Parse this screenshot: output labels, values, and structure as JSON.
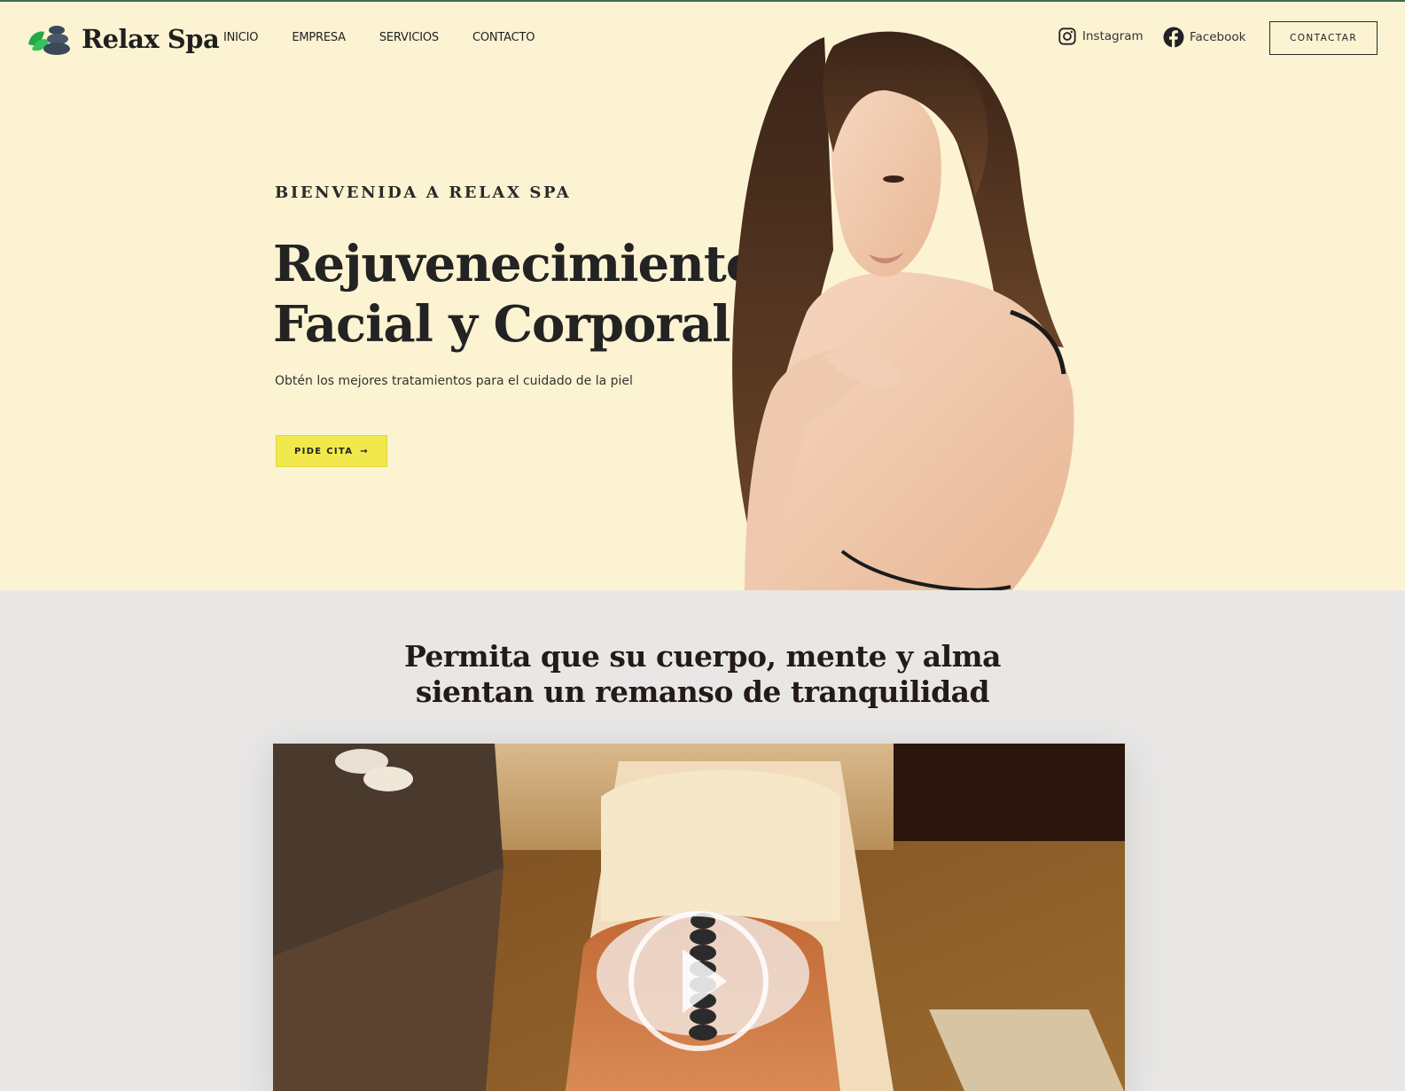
{
  "brand": {
    "name": "Relax Spa",
    "logo_icon": "spa-stones-leaf-icon"
  },
  "nav": {
    "items": [
      {
        "label": "INICIO"
      },
      {
        "label": "EMPRESA"
      },
      {
        "label": "SERVICIOS"
      },
      {
        "label": "CONTACTO"
      }
    ]
  },
  "social": {
    "instagram": {
      "label": "Instagram",
      "icon": "instagram-icon"
    },
    "facebook": {
      "label": "Facebook",
      "icon": "facebook-icon"
    }
  },
  "header": {
    "contact_button": "CONTACTAR"
  },
  "hero": {
    "eyebrow": "BIENVENIDA A RELAX SPA",
    "headline_line1": "Rejuvenecimiento",
    "headline_line2": "Facial y Corporal",
    "subtitle": "Obtén los mejores tratamientos para el cuidado de la piel",
    "cta_label": "PIDE CITA",
    "cta_icon": "arrow-right-icon"
  },
  "intro": {
    "title_line1": "Permita que su cuerpo, mente y alma",
    "title_line2": "sientan un remanso de tranquilidad"
  },
  "video": {
    "play_icon": "play-icon"
  },
  "colors": {
    "hero_bg": "#fcf3d3",
    "section_bg": "#e8e7e6",
    "cta_yellow": "#f1e84b",
    "brand_green": "#3ab54a",
    "text_dark": "#232323"
  }
}
